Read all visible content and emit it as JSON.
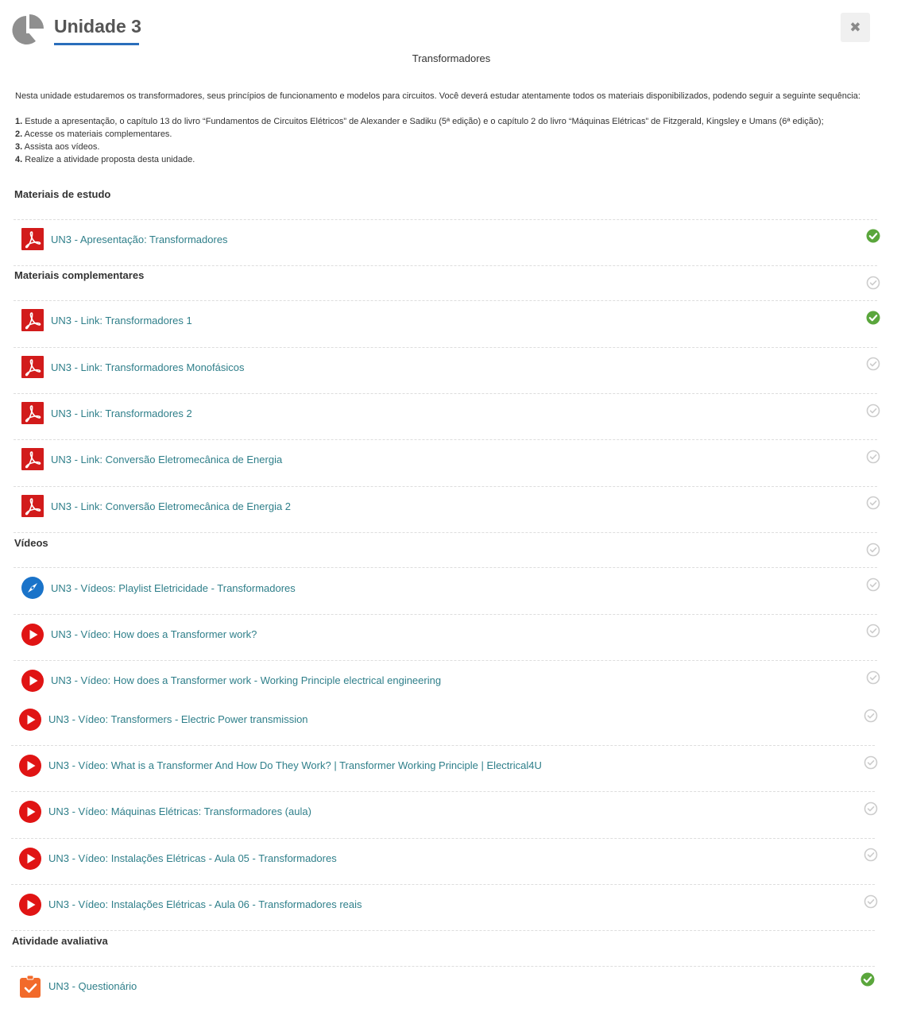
{
  "header": {
    "title": "Unidade 3",
    "close_label": "✖"
  },
  "subtitle": "Transformadores",
  "intro": "Nesta unidade estudaremos os transformadores, seus princípios de funcionamento e modelos para circuitos. Você deverá estudar atentamente todos os materiais disponibilizados, podendo seguir a seguinte sequência:",
  "steps": [
    {
      "n": "1.",
      "text": " Estude a apresentação, o capítulo 13 do livro “Fundamentos de Circuitos Elétricos” de Alexander e Sadiku (5ª edição) e o capítulo 2 do livro “Máquinas Elétricas” de Fitzgerald, Kingsley e Umans (6ª edição);"
    },
    {
      "n": "2.",
      "text": " Acesse os materiais complementares."
    },
    {
      "n": "3.",
      "text": " Assista aos vídeos."
    },
    {
      "n": "4.",
      "text": " Realize a atividade proposta desta unidade."
    }
  ],
  "sections": {
    "estudo": "Materiais de estudo",
    "complementares": "Materiais complementares",
    "videos": "Vídeos",
    "avaliativa": "Atividade avaliativa"
  },
  "items": [
    {
      "label": "UN3 - Apresentação: Transformadores",
      "icon": "pdf-icon",
      "completed": true
    },
    {
      "label": "UN3 - Link: Transformadores 1",
      "icon": "pdf-icon",
      "completed": true
    },
    {
      "label": "UN3 - Link: Transformadores Monofásicos",
      "icon": "pdf-icon",
      "completed": false
    },
    {
      "label": "UN3 - Link: Transformadores 2",
      "icon": "pdf-icon",
      "completed": false
    },
    {
      "label": "UN3 - Link: Conversão Eletromecânica de Energia",
      "icon": "pdf-icon",
      "completed": false
    },
    {
      "label": "UN3 - Link: Conversão Eletromecânica de Energia 2",
      "icon": "pdf-icon",
      "completed": false
    },
    {
      "label": "UN3 - Vídeos: Playlist Eletricidade - Transformadores",
      "icon": "compass-icon",
      "completed": false
    },
    {
      "label": "UN3 - Vídeo: How does a Transformer work?",
      "icon": "play-icon",
      "completed": false
    },
    {
      "label": "UN3 - Vídeo: How does a Transformer work - Working Principle electrical engineering",
      "icon": "play-icon",
      "completed": false
    },
    {
      "label": "UN3 - Vídeo: Transformers - Electric Power transmission",
      "icon": "play-icon",
      "completed": false
    },
    {
      "label": "UN3 - Vídeo: What is a Transformer And How Do They Work? | Transformer Working Principle | Electrical4U",
      "icon": "play-icon",
      "completed": false
    },
    {
      "label": "UN3 - Vídeo: Máquinas Elétricas: Transformadores (aula)",
      "icon": "play-icon",
      "completed": false
    },
    {
      "label": "UN3 - Vídeo: Instalações Elétricas - Aula 05 - Transformadores",
      "icon": "play-icon",
      "completed": false
    },
    {
      "label": "UN3 - Vídeo: Instalações Elétricas - Aula 06 - Transformadores reais",
      "icon": "play-icon",
      "completed": false
    },
    {
      "label": "UN3 - Questionário",
      "icon": "quiz-icon",
      "completed": true
    }
  ],
  "section_status": {
    "complementares_completed": false,
    "videos_completed": false
  },
  "colors": {
    "link": "#2f7f8a",
    "check_done": "#5aa63c",
    "check_pending": "#cccccc",
    "pdf": "#d21b1b",
    "play": "#e01414",
    "compass": "#1a73c9",
    "quiz": "#f26a2a",
    "accent_underline": "#2a6ebb"
  }
}
